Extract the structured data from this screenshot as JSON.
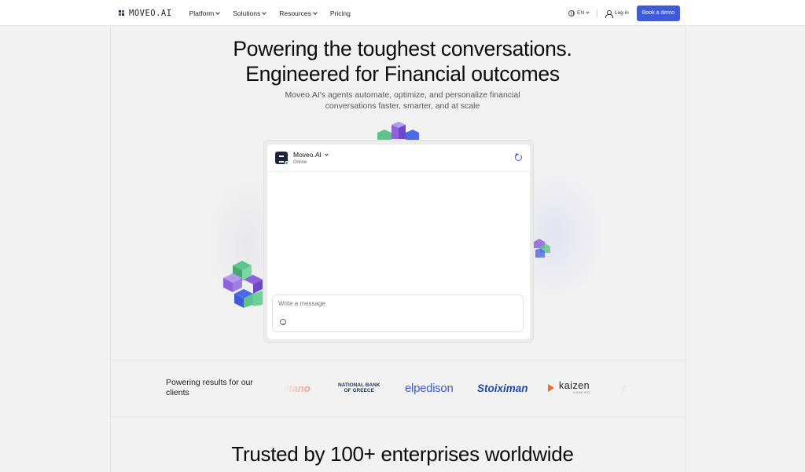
{
  "nav": {
    "logo_text": "MOVEO.AI",
    "menu": [
      {
        "label": "Platform",
        "has_dropdown": true
      },
      {
        "label": "Solutions",
        "has_dropdown": true
      },
      {
        "label": "Resources",
        "has_dropdown": true
      },
      {
        "label": "Pricing",
        "has_dropdown": false
      }
    ],
    "language": "EN",
    "login_label": "Log in",
    "cta_label": "Book a demo"
  },
  "hero": {
    "title_line1": "Powering the toughest conversations.",
    "title_line2": "Engineered for Financial outcomes",
    "subtitle_line1": "Moveo.AI's agents automate, optimize, and personalize financial",
    "subtitle_line2": "conversations faster, smarter, and at scale"
  },
  "chat": {
    "agent_name": "Moveo.AI",
    "status": "Online",
    "input_placeholder": "Write a message"
  },
  "clients": {
    "label": "Powering results for our clients",
    "logos": [
      {
        "name": "etano"
      },
      {
        "name": "NATIONAL BANK OF GREECE",
        "line1": "NATIONAL BANK",
        "line2": "OF GREECE"
      },
      {
        "name": "elpedison"
      },
      {
        "name": "Stoiximan"
      },
      {
        "name": "kaizen gaming",
        "line1": "kaizen",
        "line2": "GAMING"
      },
      {
        "name": "A"
      }
    ]
  },
  "trusted": {
    "title": "Trusted by 100+ enterprises worldwide"
  },
  "colors": {
    "accent": "#3f5bd8",
    "green": "#5cc48a",
    "purple": "#8e63d9",
    "blue": "#3f5bd8"
  }
}
